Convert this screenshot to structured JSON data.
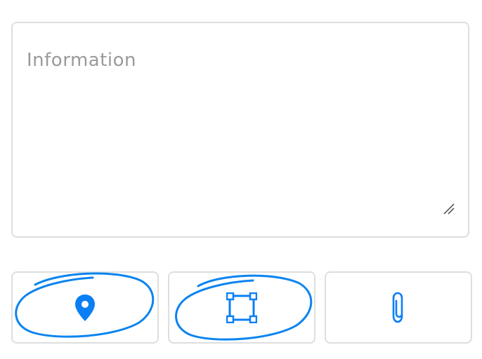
{
  "form": {
    "info_placeholder": "Information"
  },
  "actions": [
    {
      "icon": "map-pin-icon"
    },
    {
      "icon": "crop-area-icon"
    },
    {
      "icon": "paperclip-icon"
    }
  ],
  "colors": {
    "accent": "#0a7ff5",
    "border": "#dedede",
    "placeholder": "#9a9a9a",
    "highlight": "#0a84ef"
  }
}
